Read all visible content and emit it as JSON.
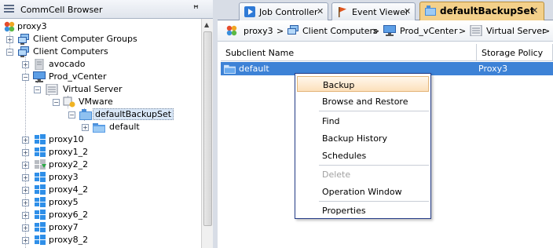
{
  "left_panel": {
    "title": "CommCell Browser",
    "pin_glyph": "ꟸ",
    "tree": {
      "root": "proxy3",
      "client_groups": "Client Computer Groups",
      "client_computers": "Client Computers",
      "avocado": "avocado",
      "prod_vcenter": "Prod_vCenter",
      "virtual_server": "Virtual Server",
      "vmware": "VMware",
      "backupset": "defaultBackupSet",
      "subclient": "default",
      "clients": [
        "proxy10",
        "proxy1_2",
        "proxy2_2",
        "proxy3",
        "proxy4_2",
        "proxy5",
        "proxy6_2",
        "proxy7",
        "proxy8_2"
      ]
    }
  },
  "tabs": [
    {
      "label": "Job Controller",
      "icon": "play-icon",
      "close": "✕"
    },
    {
      "label": "Event Viewer",
      "icon": "flag-icon",
      "close": "✕"
    },
    {
      "label": "defaultBackupSet",
      "icon": "backupset-icon",
      "close": "✕",
      "active": true
    }
  ],
  "breadcrumb": [
    "proxy3",
    "Client Computers",
    "Prod_vCenter",
    "Virtual Server"
  ],
  "breadcrumb_sep": ">",
  "table": {
    "columns": [
      "Subclient Name",
      "Storage Policy"
    ],
    "rows": [
      {
        "name": "default",
        "storage_policy": "Proxy3"
      }
    ]
  },
  "context_menu": {
    "items": [
      "Backup",
      "Browse and Restore",
      "Find",
      "Backup History",
      "Schedules",
      "Delete",
      "Operation Window",
      "Properties"
    ],
    "highlighted": "Backup",
    "disabled": [
      "Delete"
    ]
  },
  "colors": {
    "selection_blue": "#3d82d6",
    "active_tab": "#f3d08a",
    "menu_border": "#233a86"
  }
}
